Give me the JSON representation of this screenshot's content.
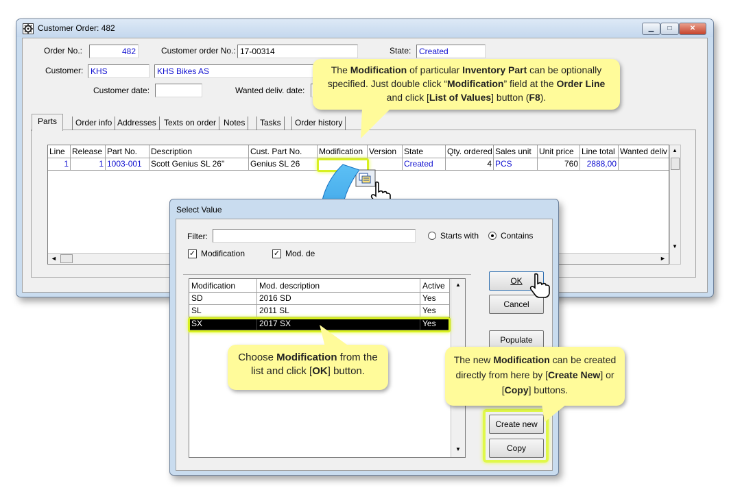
{
  "main_window": {
    "title": "Customer Order: 482",
    "form": {
      "order_no_label": "Order No.:",
      "order_no": "482",
      "customer_order_no_label": "Customer order No.:",
      "customer_order_no": "17-00314",
      "state_label": "State:",
      "state": "Created",
      "customer_label": "Customer:",
      "customer_code": "KHS",
      "customer_name": "KHS Bikes AS",
      "customer_date_label": "Customer date:",
      "customer_date": "",
      "wanted_deliv_date_label": "Wanted deliv. date:"
    },
    "tabs": [
      "Parts",
      "Order info",
      "Addresses",
      "Texts on order",
      "Notes",
      "Tasks",
      "Order history"
    ],
    "grid": {
      "columns": [
        "Line",
        "Release",
        "Part No.",
        "Description",
        "Cust. Part No.",
        "Modification",
        "Version",
        "State",
        "Qty. ordered",
        "Sales unit",
        "Unit price",
        "Line total",
        "Wanted deliv"
      ],
      "rows": [
        {
          "line": "1",
          "release": "1",
          "part_no": "1003-001",
          "description": "Scott Genius SL 26\"",
          "cust_part_no": "Genius SL 26",
          "modification": "",
          "version": "",
          "state": "Created",
          "qty": "4",
          "unit": "PCS",
          "unit_price": "760",
          "line_total": "2888,00",
          "wanted": ""
        }
      ]
    }
  },
  "dialog": {
    "title": "Select Value",
    "filter_label": "Filter:",
    "filter_value": "",
    "starts_with_label": "Starts with",
    "contains_label": "Contains",
    "chk_modification_label": "Modification",
    "chk_mod_desc_label": "Mod. de",
    "list": {
      "columns": [
        "Modification",
        "Mod. description",
        "Active"
      ],
      "rows": [
        {
          "mod": "SD",
          "desc": "2016 SD",
          "active": "Yes"
        },
        {
          "mod": "SL",
          "desc": "2011 SL",
          "active": "Yes"
        },
        {
          "mod": "SX",
          "desc": "2017 SX",
          "active": "Yes"
        }
      ],
      "selected_index": 2
    },
    "buttons": {
      "ok": "OK",
      "cancel": "Cancel",
      "populate": "Populate",
      "create_new": "Create new",
      "copy": "Copy"
    }
  },
  "callouts": {
    "top": {
      "t1": "The ",
      "b1": "Modification",
      "t2": " of particular ",
      "b2": "Inventory Part",
      "t3": " can be optionally specified.  Just double click “",
      "b3": "Modification",
      "t4": "”  field at the ",
      "b4": "Order Line",
      "t5": " and click [",
      "b5": "List of Values",
      "t6": "] button (",
      "b6": "F8",
      "t7": ")."
    },
    "middle": {
      "t1": "Choose ",
      "b1": "Modification",
      "t2": " from the list and click [",
      "b2": "OK",
      "t3": "] button."
    },
    "right": {
      "t1": "The new ",
      "b1": "Modification",
      "t2": " can be created directly from here by [",
      "b2": "Create New",
      "t3": "] or [",
      "b3": "Copy",
      "t4": "] buttons."
    }
  },
  "colors": {
    "callout_bg": "#fffb9a",
    "highlight": "#d8f020",
    "link_blue": "#1010d0",
    "arrow_blue": "#2e9ee6"
  }
}
